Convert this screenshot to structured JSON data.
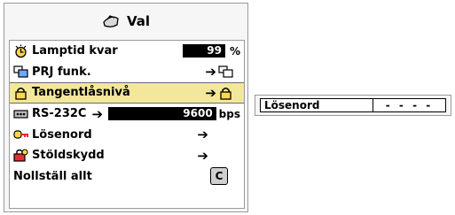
{
  "menu": {
    "title": "Val",
    "items": [
      {
        "label": "Lamptid kvar",
        "value": "99",
        "unit": "%",
        "icon": "lamp-timer-icon"
      },
      {
        "label": "PRJ funk.",
        "icon": "projector-mode-icon",
        "action": "arrow",
        "action_icon": "mode-icon"
      },
      {
        "label": "Tangentlåsnivå",
        "icon": "padlock-icon",
        "action": "arrow",
        "action_icon": "padlock-icon",
        "selected": true
      },
      {
        "label": "RS-232C",
        "value": "9600",
        "unit": "bps",
        "icon": "rs232c-port-icon",
        "action": "arrow"
      },
      {
        "label": "Lösenord",
        "icon": "key-icon",
        "action": "arrow"
      },
      {
        "label": "Stöldskydd",
        "icon": "antitheft-icon",
        "action": "arrow"
      },
      {
        "label": "Nollställ allt",
        "action_icon": "reset-icon",
        "action_text": "C"
      }
    ]
  },
  "arrow_glyph": "➔",
  "submenu": {
    "label": "Lösenord",
    "value": "- - - -"
  },
  "colors": {
    "selected_row": "#f2e79b",
    "value_box": "#000000"
  }
}
